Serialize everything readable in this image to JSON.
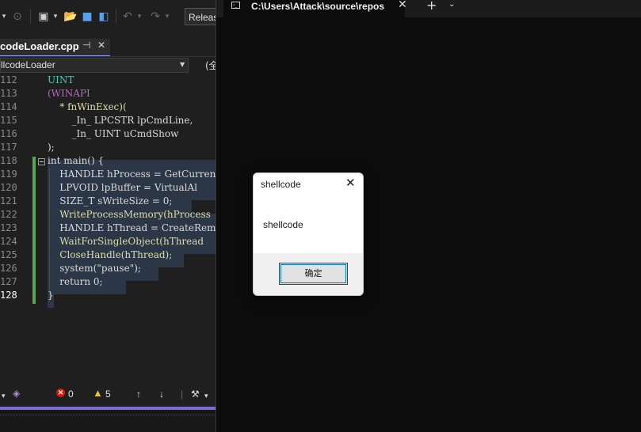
{
  "toolbar": {
    "config_value": "Releas",
    "icons": [
      "dropdown-arrow",
      "forward-nav",
      "solution-explorer",
      "open-folder",
      "save",
      "save-all",
      "undo",
      "redo"
    ]
  },
  "doc_tab": {
    "label": "codeLoader.cpp"
  },
  "nav": {
    "scope_label": "llcodeLoader",
    "member_label": "(全"
  },
  "code": [
    {
      "num": "112",
      "text": "UINT"
    },
    {
      "num": "113",
      "text": "(WINAPI"
    },
    {
      "num": "114",
      "text": "    * fnWinExec)("
    },
    {
      "num": "115",
      "text": "        _In_ LPCSTR lpCmdLine,"
    },
    {
      "num": "116",
      "text": "        _In_ UINT uCmdShow"
    },
    {
      "num": "117",
      "text": ");"
    },
    {
      "num": "118",
      "text": "int main() {"
    },
    {
      "num": "119",
      "text": "    HANDLE hProcess = GetCurren"
    },
    {
      "num": "120",
      "text": "    LPVOID lpBuffer = VirtualAl"
    },
    {
      "num": "121",
      "text": "    SIZE_T sWriteSize = 0;"
    },
    {
      "num": "122",
      "text": "    WriteProcessMemory(hProcess"
    },
    {
      "num": "123",
      "text": "    HANDLE hThread = CreateRemo"
    },
    {
      "num": "124",
      "text": "    WaitForSingleObject(hThread"
    },
    {
      "num": "125",
      "text": "    CloseHandle(hThread);"
    },
    {
      "num": "126",
      "text": "    system(\"pause\");"
    },
    {
      "num": "127",
      "text": "    return 0;"
    },
    {
      "num": "128",
      "text": "}"
    }
  ],
  "status": {
    "errors": "0",
    "warnings": "5"
  },
  "terminal": {
    "tab_title": "C:\\Users\\Attack\\source\\repos",
    "new_tab": "+",
    "dropdown": "⌄"
  },
  "dialog": {
    "title": "shellcode",
    "message": "shellcode",
    "ok_label": "确定"
  }
}
